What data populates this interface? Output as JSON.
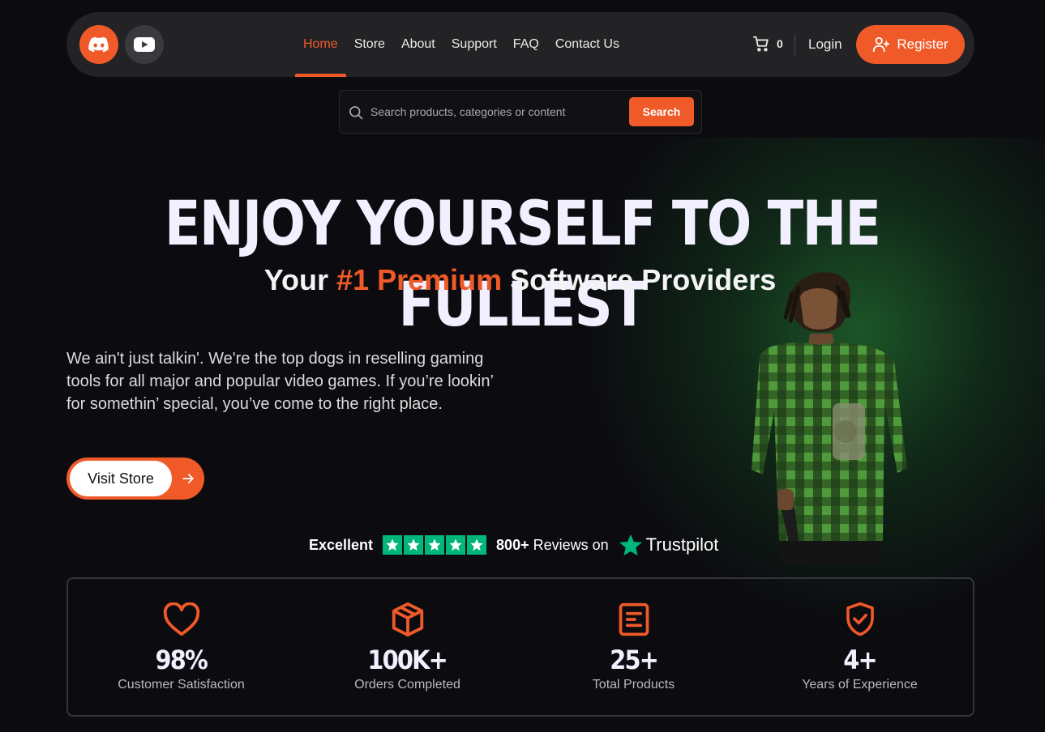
{
  "nav": {
    "social": [
      {
        "name": "discord-icon",
        "color": "#f05a28"
      },
      {
        "name": "youtube-icon",
        "color": "#3a3a3e"
      }
    ],
    "links": [
      "Home",
      "Store",
      "About",
      "Support",
      "FAQ",
      "Contact Us"
    ],
    "active": "Home",
    "cart_count": "0",
    "login": "Login",
    "register": "Register"
  },
  "search": {
    "placeholder": "Search products, categories or content",
    "button": "Search"
  },
  "hero": {
    "headline": "ENJOY YOURSELF TO THE FULLEST",
    "sub_pre": "Your ",
    "sub_accent": "#1 Premium",
    "sub_post": " Software Providers",
    "description": "We ain't just talkin'. We're the top dogs in reselling gaming tools for all major and popular video games. If you’re lookin’ for somethin’ special, you’ve come to the right place.",
    "cta": "Visit Store"
  },
  "trustpilot": {
    "rating_text": "Excellent",
    "stars": 5,
    "reviews_count": "800+",
    "reviews_text": "Reviews on",
    "brand": "Trustpilot"
  },
  "stats": [
    {
      "icon": "heart-icon",
      "value": "98%",
      "label": "Customer Satisfaction"
    },
    {
      "icon": "box-icon",
      "value": "100K+",
      "label": "Orders Completed"
    },
    {
      "icon": "document-icon",
      "value": "25+",
      "label": "Total Products"
    },
    {
      "icon": "shield-check-icon",
      "value": "4+",
      "label": "Years of Experience"
    }
  ],
  "colors": {
    "accent": "#f05a28",
    "background": "#0c0c10",
    "trustpilot_green": "#00b67a"
  }
}
